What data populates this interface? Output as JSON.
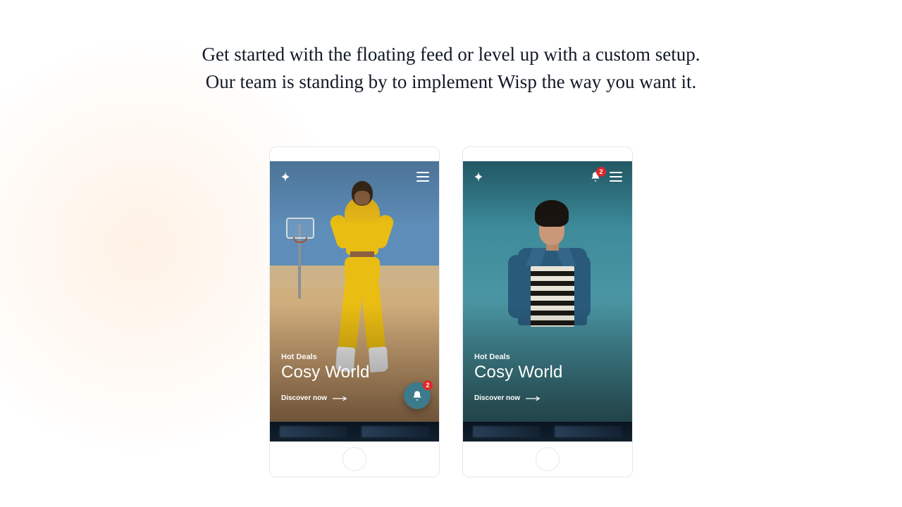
{
  "headline_line1": "Get started with the floating feed or level up with a custom setup.",
  "headline_line2": "Our team is standing by to implement Wisp the way you want it.",
  "phones": [
    {
      "variant": "floating",
      "eyebrow": "Hot Deals",
      "title": "Cosy World",
      "cta": "Discover now",
      "badge_count": "2"
    },
    {
      "variant": "header",
      "eyebrow": "Hot Deals",
      "title": "Cosy World",
      "cta": "Discover now",
      "badge_count": "2"
    }
  ]
}
